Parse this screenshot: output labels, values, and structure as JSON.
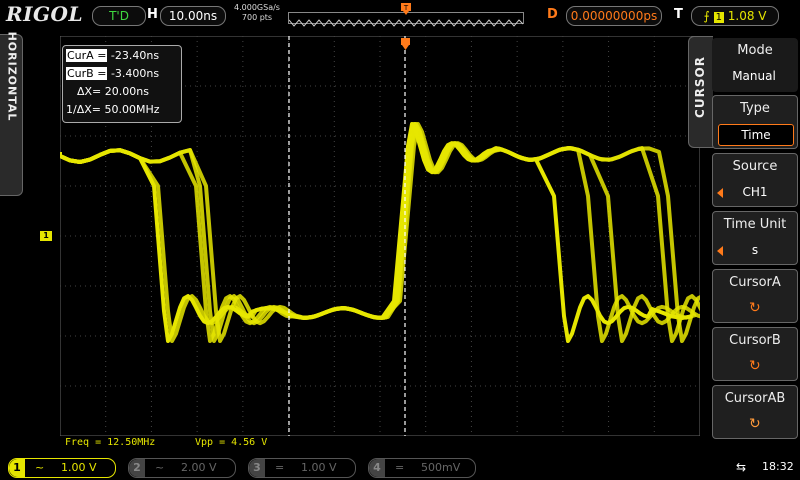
{
  "header": {
    "brand": "RIGOL",
    "run_state": "T'D",
    "horizontal_label": "H",
    "timebase": "10.00ns",
    "sample_rate": "4.000GSa/s",
    "memory_depth": "700  pts",
    "trigger_position_marker": "T",
    "delay_label": "D",
    "delay_value": "0.00000000ps",
    "trigger_label": "T",
    "trigger_source": "1",
    "trigger_level": "1.08 V"
  },
  "side_tab": {
    "label": "HORIZONTAL"
  },
  "cursor_readout": {
    "cur_a_label": "CurA =",
    "cur_a_value": "-23.40ns",
    "cur_b_label": "CurB =",
    "cur_b_value": "-3.400ns",
    "delta_x_label": "ΔX=",
    "delta_x_value": "20.00ns",
    "inv_delta_x_label": "1/ΔX=",
    "inv_delta_x_value": "50.00MHz"
  },
  "channel_marker": "1",
  "measurements": {
    "freq": "Freq = 12.50MHz",
    "vpp": "Vpp = 4.56 V"
  },
  "menu": {
    "title": "CURSOR",
    "items": [
      {
        "title": "Mode",
        "value": "Manual"
      },
      {
        "title": "Type",
        "value": "Time"
      },
      {
        "title": "Source",
        "value": "CH1"
      },
      {
        "title": "Time Unit",
        "value": "s"
      },
      {
        "title": "CursorA",
        "value": ""
      },
      {
        "title": "CursorB",
        "value": ""
      },
      {
        "title": "CursorAB",
        "value": ""
      }
    ]
  },
  "channels": [
    {
      "num": "1",
      "coupling": "~",
      "scale": "1.00 V",
      "color": "#e6e600",
      "active": true
    },
    {
      "num": "2",
      "coupling": "~",
      "scale": "2.00 V",
      "color": "#555555",
      "active": false
    },
    {
      "num": "3",
      "coupling": "=",
      "scale": "1.00 V",
      "color": "#555555",
      "active": false
    },
    {
      "num": "4",
      "coupling": "=",
      "scale": "500mV",
      "color": "#555555",
      "active": false
    }
  ],
  "status": {
    "usb": "⇆",
    "time": "18:32"
  },
  "colors": {
    "ch1": "#e6e600",
    "accent": "#ff7a1a",
    "run": "#3fd93f"
  }
}
